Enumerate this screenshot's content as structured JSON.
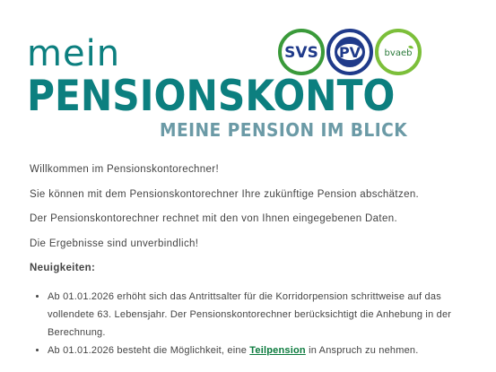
{
  "header": {
    "brand_line1": "mein",
    "brand_line2": "PENSIONSKONTO",
    "brand_tagline": "MEINE PENSION IM BLICK",
    "logos": [
      {
        "name": "svs-logo",
        "text": "SVS",
        "color": "#3a9a3a"
      },
      {
        "name": "pv-logo",
        "text": "PV",
        "color": "#1f3a8a"
      },
      {
        "name": "bvaeb-logo",
        "text": "bvaeb",
        "color": "#7cbf3a"
      }
    ]
  },
  "intro": {
    "welcome": "Willkommen im Pensionskontorechner!",
    "line2": "Sie können mit dem Pensionskontorechner Ihre zukünftige Pension abschätzen.",
    "line3": "Der Pensionskontorechner rechnet mit den von Ihnen eingegebenen Daten.",
    "line4": "Die Ergebnisse sind unverbindlich!"
  },
  "news": {
    "heading": "Neuigkeiten:",
    "items": [
      {
        "text": "Ab 01.01.2026 erhöht sich das Antrittsalter für die Korridorpension schrittweise auf das vollendete 63. Lebensjahr. Der Pensionskontorechner berücksichtigt die Anhebung in der Berechnung."
      },
      {
        "text_before": "Ab 01.01.2026 besteht die Möglichkeit, eine ",
        "link": "Teilpension",
        "text_after": " in Anspruch zu nehmen."
      }
    ]
  }
}
